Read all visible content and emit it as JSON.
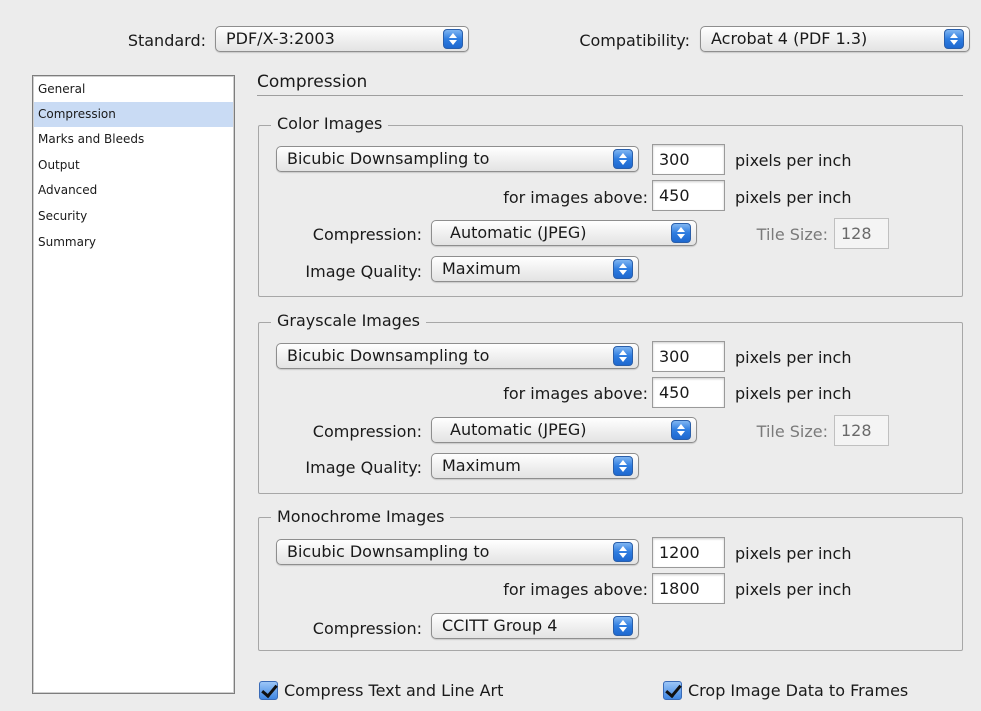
{
  "top": {
    "standard_label": "Standard:",
    "standard_value": "PDF/X-3:2003",
    "compat_label": "Compatibility:",
    "compat_value": "Acrobat 4 (PDF 1.3)"
  },
  "sidebar": {
    "items": [
      {
        "label": "General"
      },
      {
        "label": "Compression"
      },
      {
        "label": "Marks and Bleeds"
      },
      {
        "label": "Output"
      },
      {
        "label": "Advanced"
      },
      {
        "label": "Security"
      },
      {
        "label": "Summary"
      }
    ],
    "selected": "Compression"
  },
  "main": {
    "title": "Compression",
    "color": {
      "title": "Color Images",
      "downsample": "Bicubic Downsampling to",
      "ppi": "300",
      "ppi_unit": "pixels per inch",
      "above_label": "for images above:",
      "above_value": "450",
      "above_unit": "pixels per inch",
      "compression_label": "Compression:",
      "compression_value": "Automatic (JPEG)",
      "tile_label": "Tile Size:",
      "tile_value": "128",
      "quality_label": "Image Quality:",
      "quality_value": "Maximum"
    },
    "gray": {
      "title": "Grayscale Images",
      "downsample": "Bicubic Downsampling to",
      "ppi": "300",
      "ppi_unit": "pixels per inch",
      "above_label": "for images above:",
      "above_value": "450",
      "above_unit": "pixels per inch",
      "compression_label": "Compression:",
      "compression_value": "Automatic (JPEG)",
      "tile_label": "Tile Size:",
      "tile_value": "128",
      "quality_label": "Image Quality:",
      "quality_value": "Maximum"
    },
    "mono": {
      "title": "Monochrome Images",
      "downsample": "Bicubic Downsampling to",
      "ppi": "1200",
      "ppi_unit": "pixels per inch",
      "above_label": "for images above:",
      "above_value": "1800",
      "above_unit": "pixels per inch",
      "compression_label": "Compression:",
      "compression_value": "CCITT Group 4"
    },
    "compress_text": {
      "label": "Compress Text and Line Art",
      "checked": true
    },
    "crop_image": {
      "label": "Crop Image Data to Frames",
      "checked": true
    }
  }
}
